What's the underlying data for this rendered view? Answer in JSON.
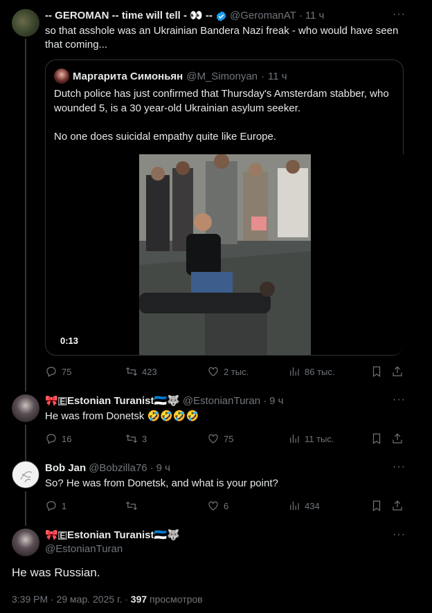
{
  "tweet1": {
    "name": "-- GEROMAN -- time will tell - 👀 --",
    "handle": "@GeromanAT",
    "time": "11 ч",
    "text": "so that asshole was an Ukrainian Bandera Nazi freak - who would have seen that coming...",
    "quote": {
      "name": "Маргарита Симоньян",
      "handle": "@M_Simonyan",
      "time": "11 ч",
      "para1": "Dutch police has just confirmed that Thursday's Amsterdam stabber, who wounded 5, is a 30 year-old Ukrainian asylum seeker.",
      "para2": "No one does suicidal empathy quite like Europe.",
      "video_duration": "0:13"
    },
    "actions": {
      "replies": "75",
      "reposts": "423",
      "likes": "2 тыс.",
      "views": "86 тыс."
    }
  },
  "tweet2": {
    "name": "🎀🇪Estonian Turanist🇪🇪🐺",
    "handle": "@EstonianTuran",
    "time": "9 ч",
    "text": "He was from Donetsk 🤣🤣🤣🤣",
    "actions": {
      "replies": "16",
      "reposts": "3",
      "likes": "75",
      "views": "11 тыс."
    }
  },
  "tweet3": {
    "name": "Bob Jan",
    "handle": "@Bobzilla76",
    "time": "9 ч",
    "text": "So? He was from Donetsk, and what is your point?",
    "actions": {
      "replies": "1",
      "reposts": "",
      "likes": "6",
      "views": "434"
    }
  },
  "main": {
    "name": "🎀🇪Estonian Turanist🇪🇪🐺",
    "handle": "@EstonianTuran",
    "text": "He was Russian.",
    "timestamp": "3:39 PM · 29 мар. 2025 г. ·",
    "views_count": "397",
    "views_label": "просмотров"
  },
  "ui": {
    "dot": "·",
    "more": "···"
  },
  "colors": {
    "background": "#000000",
    "text": "#e7e9ea",
    "muted": "#71767b",
    "border": "#2f3336",
    "verified": "#1d9bf0"
  }
}
